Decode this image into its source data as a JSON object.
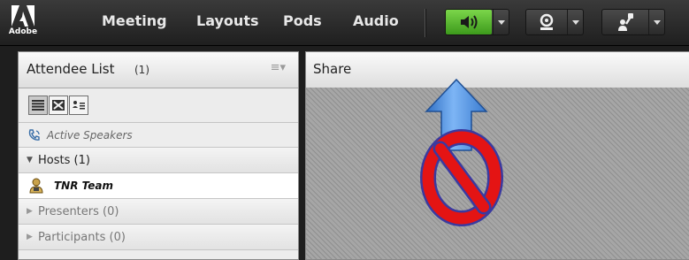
{
  "app": {
    "logo_text": "Adobe"
  },
  "menu": {
    "items": [
      "Meeting",
      "Layouts",
      "Pods",
      "Audio"
    ]
  },
  "toolbar": {
    "speaker_icon": "speaker-volume-icon",
    "camera_icon": "webcam-icon",
    "status_icon": "raise-hand-icon",
    "speaker_active_color": "#5cc12f"
  },
  "attendee_pod": {
    "title": "Attendee List",
    "count": "(1)",
    "view_buttons": [
      "list-view-icon",
      "grid-view-icon",
      "attendee-sort-icon"
    ],
    "active_speakers": "Active Speakers",
    "sections": [
      {
        "label": "Hosts (1)",
        "expanded": true,
        "users": [
          "TNR Team"
        ]
      },
      {
        "label": "Presenters (0)",
        "expanded": false
      },
      {
        "label": "Participants (0)",
        "expanded": false
      }
    ]
  },
  "share_pod": {
    "title": "Share",
    "annotation_colors": {
      "arrow": "#4a8fe0",
      "prohibit": "#e01010"
    }
  }
}
